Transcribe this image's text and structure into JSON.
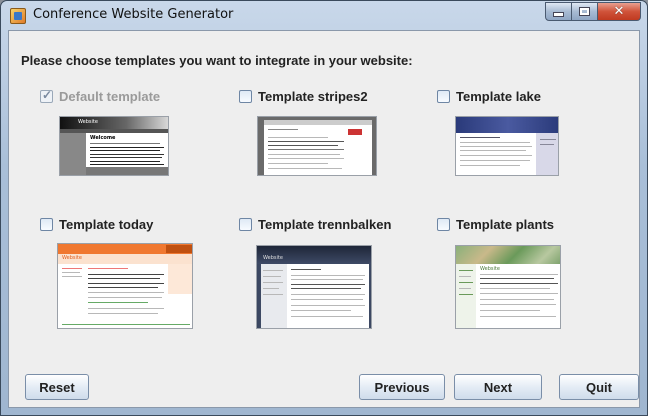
{
  "window": {
    "title": "Conference Website Generator",
    "icon": "app-icon"
  },
  "heading": "Please choose templates you want to integrate in your website:",
  "templates": [
    {
      "label": "Default template",
      "checked": true,
      "disabled": true
    },
    {
      "label": "Template stripes2",
      "checked": false,
      "disabled": false
    },
    {
      "label": "Template lake",
      "checked": false,
      "disabled": false
    },
    {
      "label": "Template today",
      "checked": false,
      "disabled": false
    },
    {
      "label": "Template trennbalken",
      "checked": false,
      "disabled": false
    },
    {
      "label": "Template plants",
      "checked": false,
      "disabled": false
    }
  ],
  "thumb_texts": {
    "default_header": "Website",
    "default_welcome": "Welcome",
    "today_header": "Website",
    "trennbalken_header": "Website",
    "plants_header": "Website"
  },
  "buttons": {
    "reset": "Reset",
    "previous": "Previous",
    "next": "Next",
    "quit": "Quit"
  },
  "colors": {
    "today_accent": "#f07830",
    "lake_accent": "#3a4a8a",
    "plants_accent": "#6a9a5a"
  }
}
